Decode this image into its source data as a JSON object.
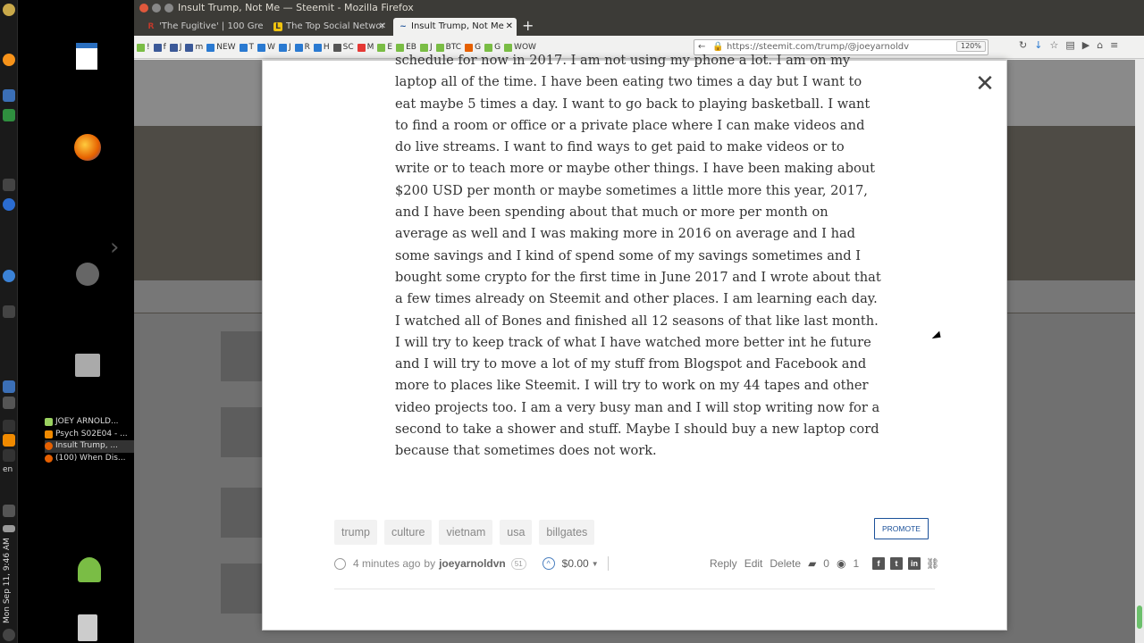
{
  "window": {
    "title": "Insult Trump, Not Me — Steemit - Mozilla Firefox"
  },
  "tabs": [
    {
      "label": "'The Fugitive' | 100 Gre",
      "favicon": "R",
      "color": "#c0392b"
    },
    {
      "label": "The Top Social Networ",
      "favicon": "L",
      "color": "#f1c40f"
    },
    {
      "label": "Insult Trump, Not Me",
      "favicon": "~",
      "color": "#1a5099"
    }
  ],
  "bookmarks": [
    "!",
    "f",
    "J",
    "m",
    "NEW",
    "T",
    "W",
    "J",
    "R",
    "H",
    "SC",
    "M",
    "E",
    "EB",
    "J",
    "BTC",
    "G",
    "G",
    "WOW"
  ],
  "url": {
    "value": "https://steemit.com/trump/@joeyarnoldv",
    "zoom": "120%"
  },
  "taskbar": [
    {
      "label": "JOEY ARNOLD...",
      "icon": "folder-icon"
    },
    {
      "label": "Psych S02E04 - ...",
      "icon": "vlc-icon"
    },
    {
      "label": "Insult Trump, ...",
      "icon": "firefox-icon"
    },
    {
      "label": "(100) When Dis...",
      "icon": "firefox-icon"
    }
  ],
  "system": {
    "lang": "en",
    "clock": "Mon Sep 11, 9:46 AM"
  },
  "post": {
    "body": "schedule for now in 2017. I am not using my phone a lot. I am on my laptop all of the time. I have been eating two times a day but I want to eat maybe 5 times a day. I want to go back to playing basketball. I want to find a room or office or a private place where I can make videos and do live streams. I want to find ways to get paid to make videos or to write or to teach more or maybe other things. I have been making about $200 USD per month or maybe sometimes a little more this year, 2017, and I have been spending about that much or more per month on average as well and I was making more in 2016 on average and I had some savings and I kind of spend some of my savings sometimes and I bought some crypto for the first time in June 2017 and I wrote about that a few times already on Steemit and other places. I am learning each day. I watched all of Bones and finished all 12 seasons of that like last month. I will try to keep track of what I have watched more better int he future and I will try to move a lot of my stuff from Blogspot and Facebook and more to places like Steemit. I will try to work on my 44 tapes and other video projects too. I am a very busy man and I will stop writing now for a second to take a shower and stuff. Maybe I should buy a new laptop cord because that sometimes does not work.",
    "tags": [
      "trump",
      "culture",
      "vietnam",
      "usa",
      "billgates"
    ],
    "promote_label": "PROMOTE",
    "time_ago": "4 minutes ago",
    "by": "by",
    "author": "joeyarnoldvn",
    "reputation": "51",
    "payout": "$0.00",
    "actions": {
      "reply": "Reply",
      "edit": "Edit",
      "delete": "Delete"
    },
    "comments": "0",
    "views": "1"
  }
}
